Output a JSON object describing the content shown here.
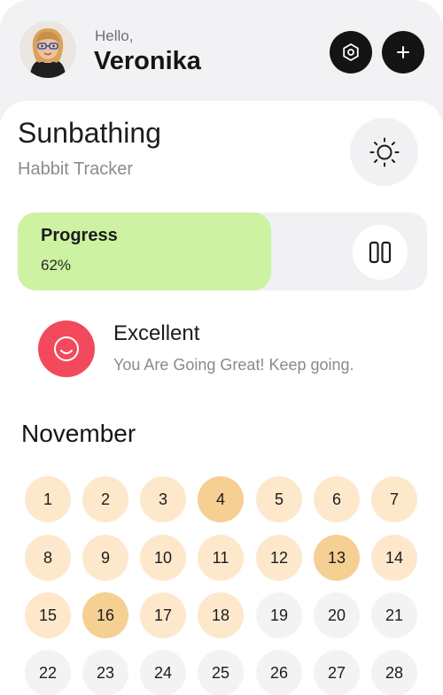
{
  "header": {
    "greeting": "Hello,",
    "username": "Veronika",
    "settings_icon": "hexagon-gear-icon",
    "add_icon": "plus-icon"
  },
  "habit": {
    "title": "Sunbathing",
    "subtitle": "Habbit Tracker",
    "icon": "sun-icon"
  },
  "progress": {
    "label": "Progress",
    "value_text": "62%",
    "fraction": 0.62,
    "control_icon": "pause-icon"
  },
  "status": {
    "title": "Excellent",
    "message": "You Are Going Great! Keep going.",
    "icon": "smile-icon",
    "color": "#f24a5c"
  },
  "calendar": {
    "month": "November",
    "colors": {
      "active": "#fde8cc",
      "highlight": "#f6cf93",
      "future": "#f3f3f5",
      "progress": "#ccf2a2"
    },
    "days": [
      {
        "label": "1",
        "state": "active"
      },
      {
        "label": "2",
        "state": "active"
      },
      {
        "label": "3",
        "state": "active"
      },
      {
        "label": "4",
        "state": "highlight"
      },
      {
        "label": "5",
        "state": "active"
      },
      {
        "label": "6",
        "state": "active"
      },
      {
        "label": "7",
        "state": "active"
      },
      {
        "label": "8",
        "state": "active"
      },
      {
        "label": "9",
        "state": "active"
      },
      {
        "label": "10",
        "state": "active"
      },
      {
        "label": "11",
        "state": "active"
      },
      {
        "label": "12",
        "state": "active"
      },
      {
        "label": "13",
        "state": "highlight"
      },
      {
        "label": "14",
        "state": "active"
      },
      {
        "label": "15",
        "state": "active"
      },
      {
        "label": "16",
        "state": "highlight"
      },
      {
        "label": "17",
        "state": "active"
      },
      {
        "label": "18",
        "state": "active"
      },
      {
        "label": "19",
        "state": "future"
      },
      {
        "label": "20",
        "state": "future"
      },
      {
        "label": "21",
        "state": "future"
      },
      {
        "label": "22",
        "state": "future"
      },
      {
        "label": "23",
        "state": "future"
      },
      {
        "label": "24",
        "state": "future"
      },
      {
        "label": "25",
        "state": "future"
      },
      {
        "label": "26",
        "state": "future"
      },
      {
        "label": "27",
        "state": "future"
      },
      {
        "label": "28",
        "state": "future"
      }
    ]
  }
}
